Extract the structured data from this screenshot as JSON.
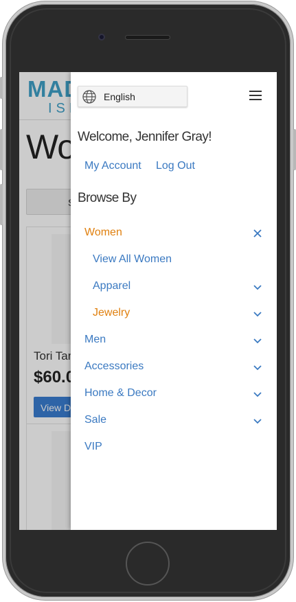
{
  "background_page": {
    "logo_line1": "MAD",
    "logo_line2": "ISL",
    "title": "Wo",
    "sort_label": "S",
    "product": {
      "name": "Tori Tan",
      "price": "$60.0",
      "button_label": "View D"
    }
  },
  "drawer": {
    "language": {
      "icon": "globe-icon",
      "label": "English"
    },
    "menu_icon": "hamburger-icon",
    "welcome": "Welcome, Jennifer Gray!",
    "links": {
      "my_account": "My Account",
      "log_out": "Log Out"
    },
    "browse_heading": "Browse By",
    "categories": [
      {
        "label": "Women",
        "level": 0,
        "state": "active",
        "toggle_icon": "close-icon"
      },
      {
        "label": "View All Women",
        "level": 1,
        "state": "normal",
        "toggle_icon": ""
      },
      {
        "label": "Apparel",
        "level": 1,
        "state": "normal",
        "toggle_icon": "chevron-down-icon"
      },
      {
        "label": "Jewelry",
        "level": 1,
        "state": "active",
        "toggle_icon": "chevron-down-icon"
      },
      {
        "label": "Men",
        "level": 0,
        "state": "normal",
        "toggle_icon": "chevron-down-icon"
      },
      {
        "label": "Accessories",
        "level": 0,
        "state": "normal",
        "toggle_icon": "chevron-down-icon"
      },
      {
        "label": "Home & Decor",
        "level": 0,
        "state": "normal",
        "toggle_icon": "chevron-down-icon"
      },
      {
        "label": "Sale",
        "level": 0,
        "state": "normal",
        "toggle_icon": "chevron-down-icon"
      },
      {
        "label": "VIP",
        "level": 0,
        "state": "normal",
        "toggle_icon": ""
      }
    ]
  },
  "colors": {
    "link_blue": "#3a79c1",
    "active_orange": "#e0800f",
    "logo_blue": "#3fa0c7",
    "button_blue": "#3a7dd1"
  }
}
